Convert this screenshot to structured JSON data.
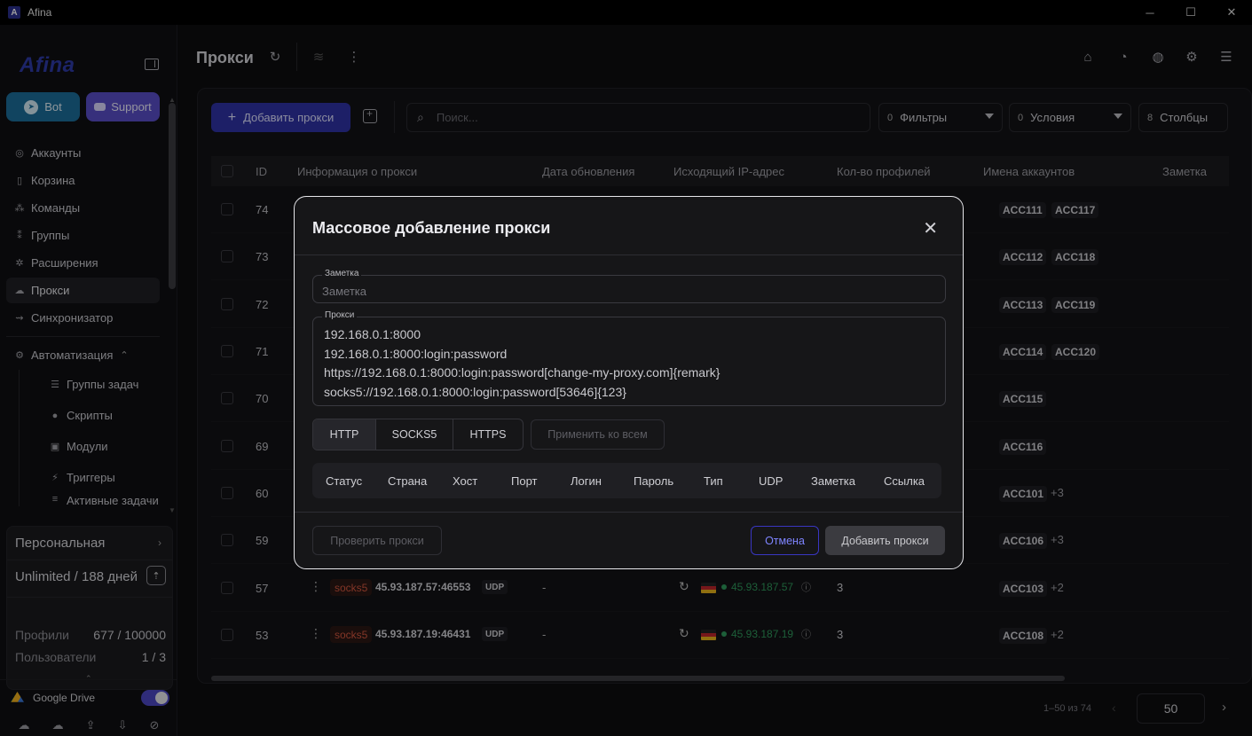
{
  "window": {
    "title": "Afina",
    "controls": [
      "─",
      "☐",
      "✕"
    ]
  },
  "sidebar": {
    "brand": "Afina",
    "bot_label": "Bot",
    "support_label": "Support",
    "items": [
      {
        "label": "Аккаунты",
        "icon": "user-circle-icon",
        "glyph": "◎"
      },
      {
        "label": "Корзина",
        "icon": "trash-icon",
        "glyph": "▯"
      },
      {
        "label": "Команды",
        "icon": "team-icon",
        "glyph": "⁂"
      },
      {
        "label": "Группы",
        "icon": "users-icon",
        "glyph": "⁑"
      },
      {
        "label": "Расширения",
        "icon": "puzzle-icon",
        "glyph": "✲"
      },
      {
        "label": "Прокси",
        "icon": "cloud-icon",
        "glyph": "☁"
      },
      {
        "label": "Синхронизатор",
        "icon": "sync-icon",
        "glyph": "⇝"
      }
    ],
    "automation": {
      "label": "Автоматизация",
      "glyph": "⚙",
      "chevron": "⌃"
    },
    "sub_items": [
      {
        "label": "Группы задач",
        "icon": "list-icon",
        "glyph": "☰"
      },
      {
        "label": "Скрипты",
        "icon": "github-icon",
        "glyph": "●"
      },
      {
        "label": "Модули",
        "icon": "terminal-icon",
        "glyph": "▣"
      },
      {
        "label": "Триггеры",
        "icon": "bolt-icon",
        "glyph": "⚡"
      },
      {
        "label": "Активные задачи",
        "icon": "tasks-icon",
        "glyph": "≡"
      }
    ],
    "plan": {
      "name": "Персональная",
      "limit": "Unlimited / 188 дней",
      "profiles_label": "Профили",
      "profiles_value": "677 / 100000",
      "users_label": "Пользователи",
      "users_value": "1 / 3"
    },
    "gdrive_label": "Google Drive",
    "gdrive_enabled": true,
    "bottom_icons": [
      "☁",
      "☁",
      "⇪",
      "⇩",
      "⊘"
    ]
  },
  "main": {
    "title": "Прокси",
    "add_button": "Добавить прокси",
    "search_placeholder": "Поиск...",
    "filters": {
      "count": "0",
      "label": "Фильтры"
    },
    "conditions": {
      "count": "0",
      "label": "Условия"
    },
    "columns": {
      "count": "8",
      "label": "Столбцы"
    },
    "table_headers": [
      "ID",
      "Информация о прокси",
      "Дата обновления",
      "Исходящий IP-адрес",
      "Кол-во профилей",
      "Имена аккаунтов",
      "Заметка"
    ],
    "rows": [
      {
        "id": "74",
        "accounts": [
          "ACC111",
          "ACC117"
        ],
        "more": ""
      },
      {
        "id": "73",
        "accounts": [
          "ACC112",
          "ACC118"
        ],
        "more": ""
      },
      {
        "id": "72",
        "accounts": [
          "ACC113",
          "ACC119"
        ],
        "more": ""
      },
      {
        "id": "71",
        "accounts": [
          "ACC114",
          "ACC120"
        ],
        "more": ""
      },
      {
        "id": "70",
        "accounts": [
          "ACC115"
        ],
        "more": ""
      },
      {
        "id": "69",
        "accounts": [
          "ACC116"
        ],
        "more": ""
      },
      {
        "id": "60",
        "accounts": [
          "ACC101"
        ],
        "more": "+3"
      },
      {
        "id": "59",
        "accounts": [
          "ACC106"
        ],
        "more": "+3"
      },
      {
        "id": "57",
        "accounts": [
          "ACC103"
        ],
        "more": "+2",
        "proto": "socks5",
        "host": "45.93.187.57:46553",
        "udp": "UDP",
        "date": "-",
        "ip": "45.93.187.57",
        "profiles": "3"
      },
      {
        "id": "53",
        "accounts": [
          "ACC108"
        ],
        "more": "+2",
        "proto": "socks5",
        "host": "45.93.187.19:46431",
        "udp": "UDP",
        "date": "-",
        "ip": "45.93.187.19",
        "profiles": "3"
      }
    ],
    "pager": {
      "range": "1–50 из 74",
      "page_size": "50"
    }
  },
  "modal": {
    "title": "Массовое добавление прокси",
    "note_legend": "Заметка",
    "note_placeholder": "Заметка",
    "proxy_legend": "Прокси",
    "proxy_text": "192.168.0.1:8000\n192.168.0.1:8000:login:password\nhttps://192.168.0.1:8000:login:password[change-my-proxy.com]{remark}\nsocks5://192.168.0.1:8000:login:password[53646]{123}",
    "types": [
      "HTTP",
      "SOCKS5",
      "HTTPS"
    ],
    "selected_type": "HTTP",
    "apply_all": "Применить ко всем",
    "preview_headers": [
      "Статус",
      "Страна",
      "Хост",
      "Порт",
      "Логин",
      "Пароль",
      "Тип",
      "UDP",
      "Заметка",
      "Ссылка"
    ],
    "check_button": "Проверить прокси",
    "cancel_button": "Отмена",
    "submit_button": "Добавить прокси"
  }
}
